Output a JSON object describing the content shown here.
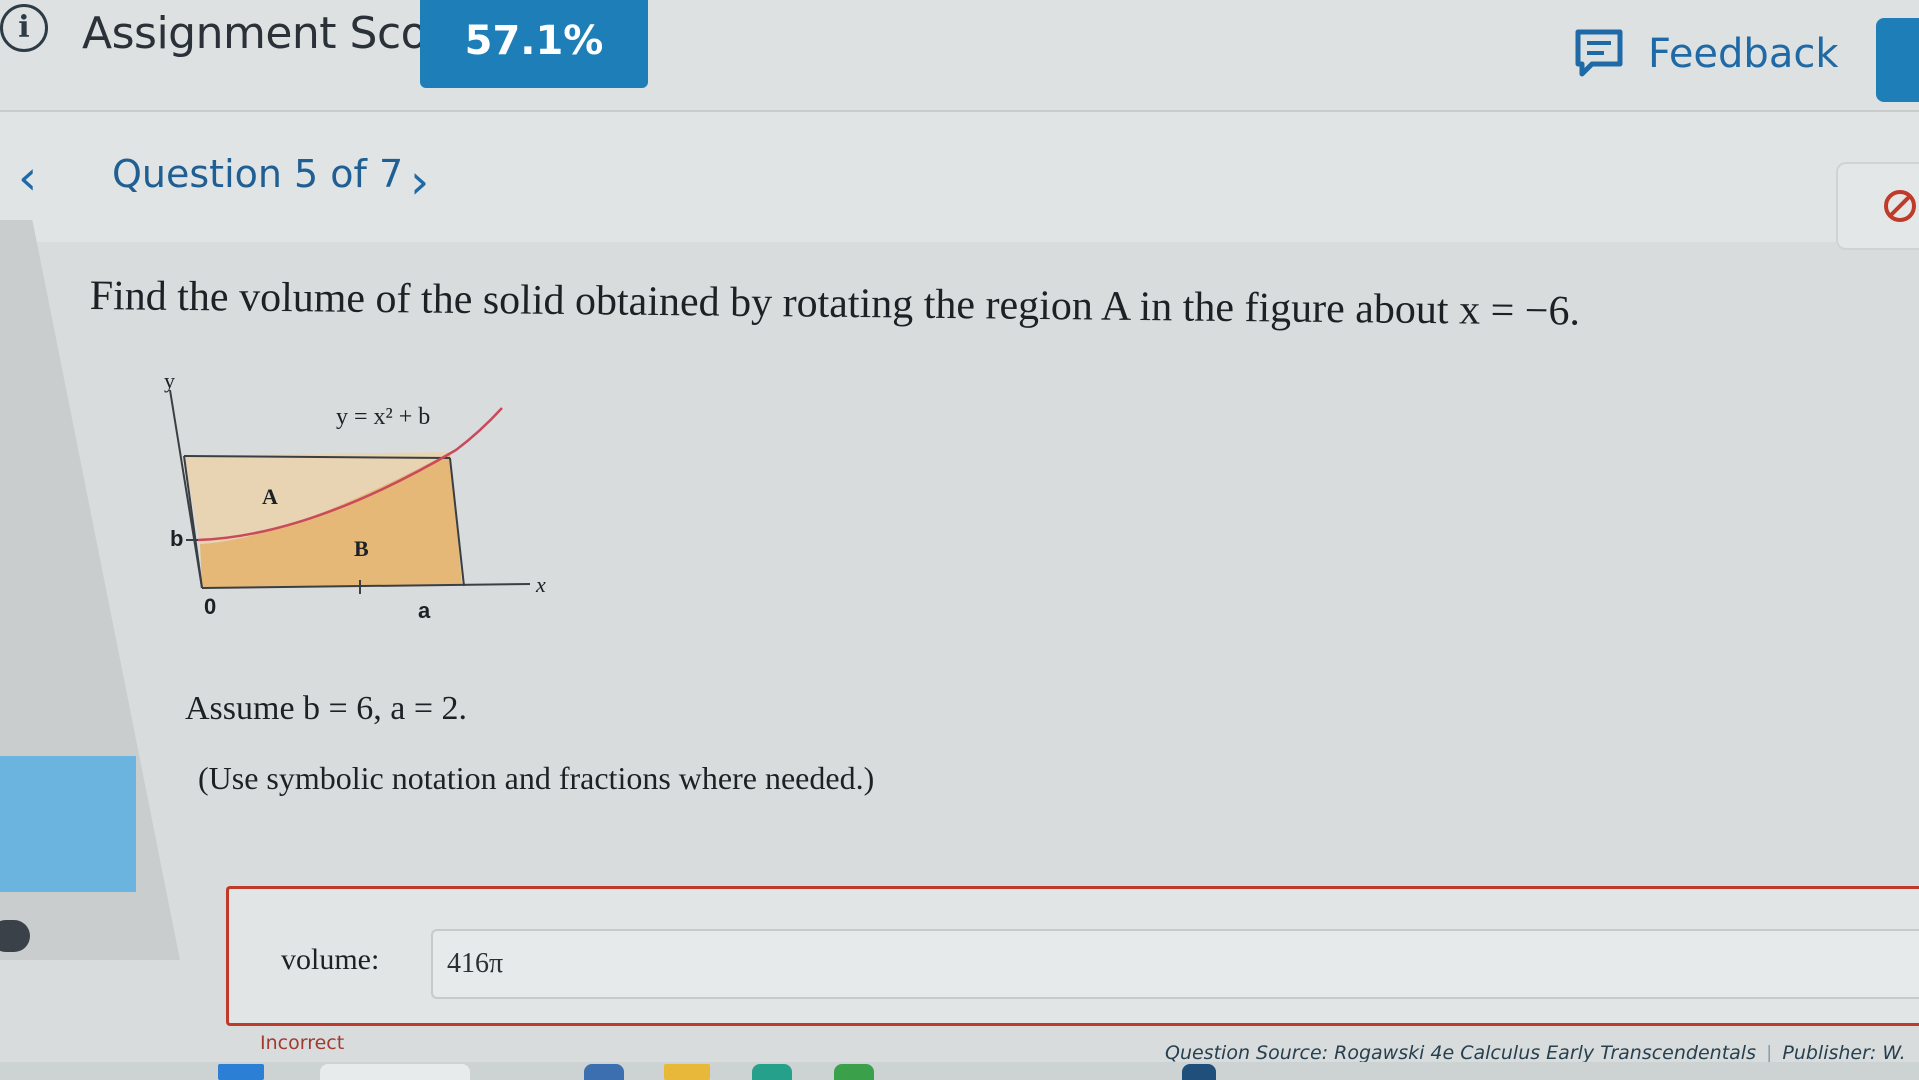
{
  "header": {
    "score_label": "Assignment Score:",
    "score_value": "57.1%",
    "feedback_label": "Feedback"
  },
  "nav": {
    "question_title": "Question 5 of 7",
    "prev_symbol": "‹",
    "next_symbol": "›"
  },
  "question": {
    "prompt": "Find the volume of the solid obtained by rotating the region A in the figure about x = −6.",
    "figure": {
      "equation": "y = x² + b",
      "label_y": "y",
      "label_x": "x",
      "label_b": "b",
      "label_0": "0",
      "label_a": "a",
      "region_A": "A",
      "region_B": "B"
    },
    "assumption": "Assume b = 6,  a = 2.",
    "note": "(Use symbolic notation and fractions where needed.)"
  },
  "answer": {
    "label": "volume:",
    "value": "416π",
    "status": "Incorrect"
  },
  "footer": {
    "source": "Question Source: Rogawski 4e Calculus Early Transcendentals",
    "publisher": "Publisher: W."
  },
  "colors": {
    "accent": "#1e7fb8",
    "error": "#c03a2b",
    "region_fill": "#e6b877",
    "region_A_fill": "#e8d3b3"
  }
}
